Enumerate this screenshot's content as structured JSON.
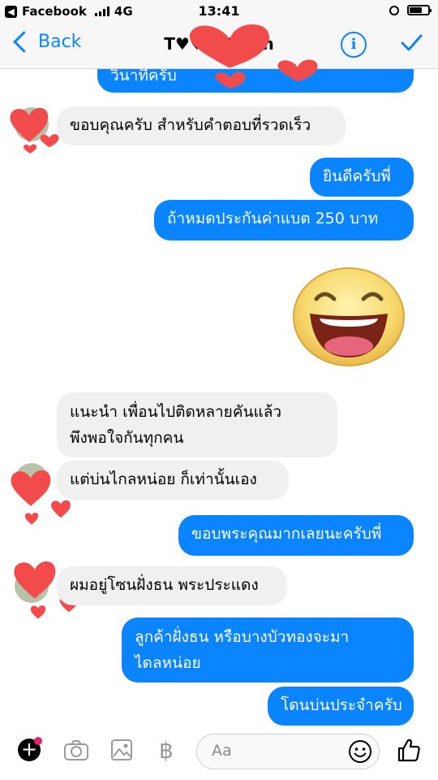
{
  "status_bar": {
    "carrier": "Facebook",
    "network": "4G",
    "time": "13:41"
  },
  "nav": {
    "back_label": "Back",
    "title": "T♥♥♥♥♥♥n",
    "info_label": "i"
  },
  "messages": [
    {
      "id": 0,
      "from": "me",
      "text": "วินาทีครับ"
    },
    {
      "id": 1,
      "from": "them",
      "text": "ขอบคุณครับ สำหรับคำตอบที่รวดเร็ว"
    },
    {
      "id": 2,
      "from": "me",
      "text": "ยินดีครับพี่"
    },
    {
      "id": 3,
      "from": "me",
      "text": "ถ้าหมดประกันค่าแบต 250 บาท"
    },
    {
      "id": 4,
      "from": "them",
      "text_line1": "แนะนำ เพื่อนไปติดหลายคันแล้ว",
      "text_line2": "พึงพอใจกันทุกคน"
    },
    {
      "id": 5,
      "from": "them",
      "text": "แต่บ่นไกลหน่อย ก็เท่านั้นเอง"
    },
    {
      "id": 6,
      "from": "me",
      "text": "ขอบพระคุณมากเลยนะครับพี่"
    },
    {
      "id": 7,
      "from": "them",
      "text": "ผมอยู่โซนฝั่งธน พระประแดง"
    },
    {
      "id": 8,
      "from": "me",
      "text_line1": "ลูกค้าฝั่งธน หรือบางบัวทองจะมา",
      "text_line2": "ไดลหน่อย"
    },
    {
      "id": 9,
      "from": "me",
      "text": "โดนบ่นประจำครับ"
    }
  ],
  "sticker": {
    "name": "laughing-emoji-sticker"
  },
  "composer": {
    "placeholder": "Aa",
    "currency_symbol": "฿"
  },
  "colors": {
    "accent": "#0a84ff",
    "incoming_bubble": "#f0f0f0",
    "redaction_heart": "#f24b4b"
  },
  "icons": [
    "plus-icon",
    "camera-icon",
    "gallery-icon",
    "baht-icon",
    "smile-icon",
    "thumbs-up-icon",
    "info-icon",
    "check-icon",
    "back-chevron-icon"
  ]
}
